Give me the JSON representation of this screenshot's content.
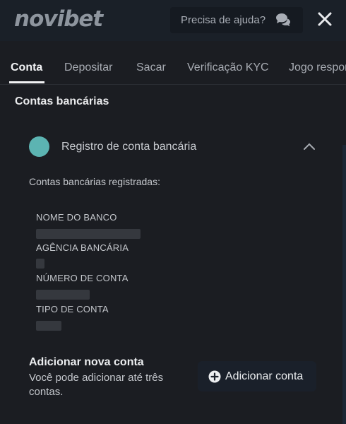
{
  "header": {
    "logo_text": "novibet",
    "help_label": "Precisa de ajuda?",
    "help_icon": "chat-bubbles-icon",
    "close_icon": "close-icon"
  },
  "tabs": [
    {
      "label": "Conta",
      "active": true
    },
    {
      "label": "Depositar",
      "active": false
    },
    {
      "label": "Sacar",
      "active": false
    },
    {
      "label": "Verificação KYC",
      "active": false
    },
    {
      "label": "Jogo respor",
      "active": false
    }
  ],
  "section": {
    "title": "Contas bancárias"
  },
  "panel": {
    "title": "Registro de conta bancária",
    "expanded": true,
    "registered_label": "Contas bancárias registradas:",
    "fields": [
      {
        "label": "NOME DO BANCO"
      },
      {
        "label": "AGÊNCIA BANCÁRIA"
      },
      {
        "label": "NÚMERO DE CONTA"
      },
      {
        "label": "TIPO DE CONTA"
      }
    ]
  },
  "add_account": {
    "title": "Adicionar nova conta",
    "description": "Você pode adicionar até três contas.",
    "button_label": "Adicionar conta",
    "button_icon": "plus-circle-icon"
  },
  "colors": {
    "background": "#1b1d22",
    "header_bg": "#1a2028",
    "bank_dot": "#5cb4b2"
  }
}
